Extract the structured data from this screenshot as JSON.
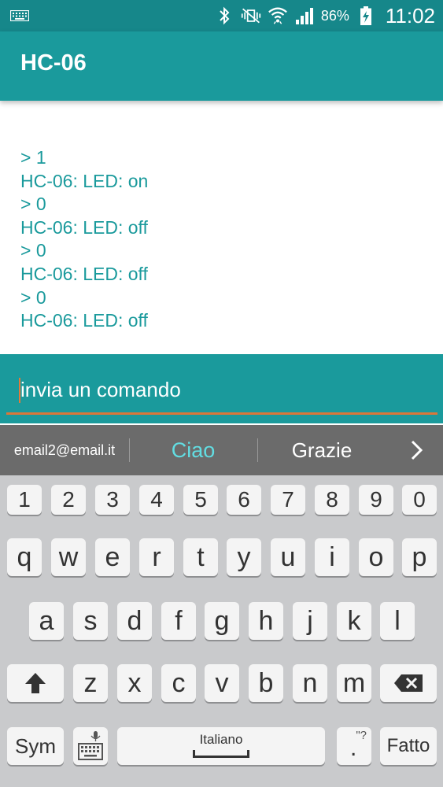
{
  "status_bar": {
    "battery_percent": "86%",
    "time": "11:02",
    "icons": [
      "keyboard-icon",
      "bluetooth-icon",
      "vibrate-mute-icon",
      "wifi-icon",
      "signal-icon",
      "battery-charging-icon"
    ]
  },
  "app_bar": {
    "title": "HC-06"
  },
  "console": {
    "lines": [
      "> 1",
      "HC-06: LED: on",
      "> 0",
      "HC-06: LED: off",
      "> 0",
      "HC-06: LED: off",
      "> 0",
      "HC-06: LED: off"
    ]
  },
  "input": {
    "placeholder": "invia un comando",
    "value": ""
  },
  "suggestions": {
    "items": [
      "email2@email.it",
      "Ciao",
      "Grazie"
    ],
    "arrow": "›"
  },
  "keyboard": {
    "numbers": [
      "1",
      "2",
      "3",
      "4",
      "5",
      "6",
      "7",
      "8",
      "9",
      "0"
    ],
    "row1": [
      "q",
      "w",
      "e",
      "r",
      "t",
      "y",
      "u",
      "i",
      "o",
      "p"
    ],
    "row2": [
      "a",
      "s",
      "d",
      "f",
      "g",
      "h",
      "j",
      "k",
      "l"
    ],
    "row3": [
      "z",
      "x",
      "c",
      "v",
      "b",
      "n",
      "m"
    ],
    "sym_label": "Sym",
    "space_label": "Italiano",
    "period_label": ".",
    "period_alt": "\"?",
    "done_label": "Fatto"
  },
  "colors": {
    "status_bar": "#16878a",
    "primary": "#1a9a9c",
    "accent": "#d9773a",
    "suggestion_highlight": "#62dde2"
  }
}
